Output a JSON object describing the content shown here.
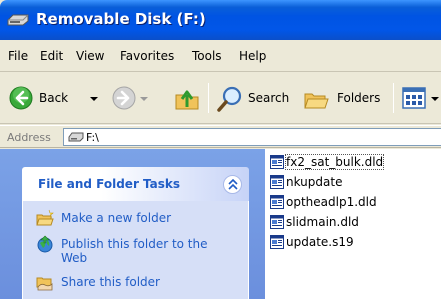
{
  "window": {
    "title": "Removable Disk (F:)",
    "icon": "removable-drive-icon"
  },
  "menubar": {
    "items": [
      "File",
      "Edit",
      "View",
      "Favorites",
      "Tools",
      "Help"
    ]
  },
  "toolbar": {
    "back_label": "Back",
    "search_label": "Search",
    "folders_label": "Folders",
    "icons": [
      "back-arrow-icon",
      "forward-arrow-icon",
      "up-folder-icon",
      "search-icon",
      "folders-icon",
      "views-icon"
    ]
  },
  "address": {
    "label": "Address",
    "value": "F:\\"
  },
  "task_pane": {
    "header": "File and Folder Tasks",
    "links": [
      {
        "label": "Make a new folder",
        "icon": "new-folder-icon"
      },
      {
        "label": "Publish this folder to the Web",
        "icon": "publish-web-icon"
      },
      {
        "label": "Share this folder",
        "icon": "share-folder-icon"
      }
    ]
  },
  "files": [
    {
      "name": "fx2_sat_bulk.dld",
      "icon": "file-icon",
      "selected": true
    },
    {
      "name": "nkupdate",
      "icon": "file-icon",
      "selected": false
    },
    {
      "name": "optheadlp1.dld",
      "icon": "file-icon",
      "selected": false
    },
    {
      "name": "slidmain.dld",
      "icon": "file-icon",
      "selected": false
    },
    {
      "name": "update.s19",
      "icon": "file-icon",
      "selected": false
    }
  ],
  "colors": {
    "titlebar": "#0054e3",
    "task_pane_bg": "#6b8fdd",
    "task_link": "#215dc6",
    "task_body": "#d6dff7"
  }
}
